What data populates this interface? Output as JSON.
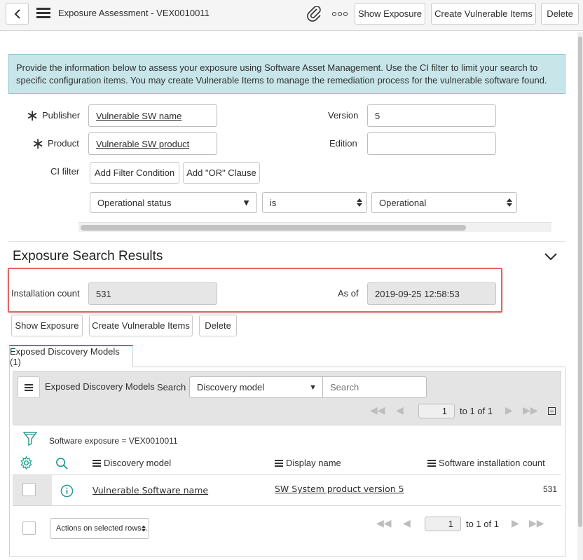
{
  "header": {
    "title": "Exposure Assessment - VEX0010011",
    "buttons": {
      "show_exposure": "Show Exposure",
      "create_vulnerable_items": "Create Vulnerable Items",
      "delete": "Delete"
    }
  },
  "info_banner": "Provide the information below to assess your exposure using Software Asset Management. Use the CI filter to limit your search to specific configuration items. You may create Vulnerable Items to manage the remediation process for the vulnerable software found.",
  "form": {
    "publisher_label": "Publisher",
    "publisher_value": "Vulnerable SW name",
    "product_label": "Product",
    "product_value": "Vulnerable SW product",
    "version_label": "Version",
    "version_value": "5",
    "edition_label": "Edition",
    "edition_value": "",
    "ci_filter_label": "CI filter",
    "add_filter_condition": "Add Filter Condition",
    "add_or_clause": "Add \"OR\" Clause",
    "condition": {
      "field": "Operational status",
      "operator": "is",
      "value": "Operational"
    }
  },
  "results": {
    "title": "Exposure Search Results",
    "installation_count_label": "Installation count",
    "installation_count_value": "531",
    "as_of_label": "As of",
    "as_of_value": "2019-09-25 12:58:53",
    "buttons": {
      "show_exposure": "Show Exposure",
      "create_vulnerable_items": "Create Vulnerable Items",
      "delete": "Delete"
    }
  },
  "related_list": {
    "tab_label": "Exposed Discovery Models (1)",
    "list_title": "Exposed Discovery Models",
    "search_label": "Search",
    "search_field": "Discovery model",
    "search_placeholder": "Search",
    "pager": {
      "page": "1",
      "range": "to 1 of 1"
    },
    "breadcrumb": "Software exposure = VEX0010011",
    "columns": [
      "Discovery model",
      "Display name",
      "Software installation count"
    ],
    "rows": [
      {
        "discovery_model": "Vulnerable Software name",
        "display_name": "SW System product version 5",
        "installation_count": "531"
      }
    ],
    "actions_select": "Actions on selected rows...",
    "footer_pager": {
      "page": "1",
      "range": "to 1 of 1"
    }
  },
  "colors": {
    "banner_bg": "#c8e6ea",
    "banner_border": "#8fc7cf",
    "highlight_border": "#e06666",
    "accent_teal": "#2a9d8f"
  }
}
